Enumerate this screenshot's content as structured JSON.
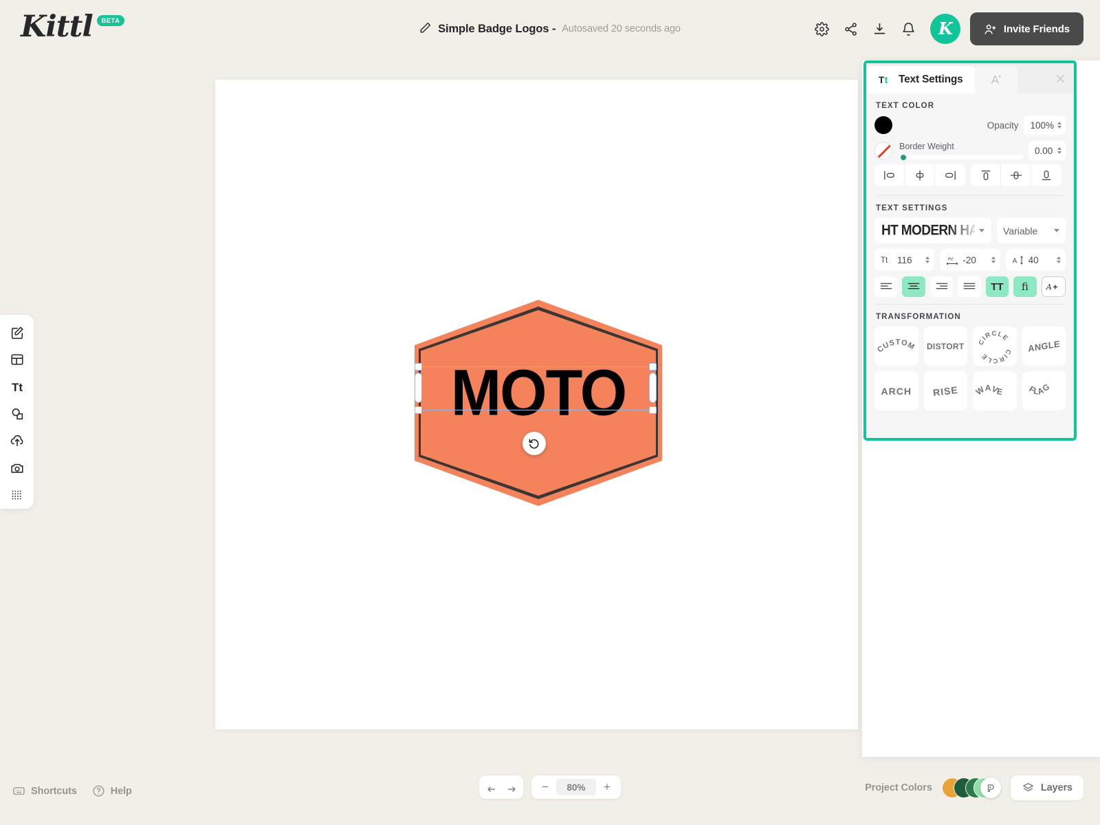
{
  "app": {
    "logo_text": "Kittl",
    "logo_badge": "BETA",
    "accent_color": "#12c49a",
    "canvas_bg": "#f2efe9"
  },
  "header": {
    "doc_name": "Simple Badge Logos -",
    "autosave_text": "Autosaved 20 seconds ago",
    "icons": [
      "gear-icon",
      "share-icon",
      "download-icon",
      "bell-icon"
    ],
    "avatar_letter": "K",
    "invite_label": "Invite Friends"
  },
  "left_toolbar": {
    "items": [
      {
        "name": "design-tool",
        "icon": "pencil-square-icon"
      },
      {
        "name": "templates-tool",
        "icon": "layout-icon"
      },
      {
        "name": "text-tool",
        "icon": "text-Tt-icon"
      },
      {
        "name": "elements-tool",
        "icon": "shapes-icon"
      },
      {
        "name": "uploads-tool",
        "icon": "cloud-upload-icon"
      },
      {
        "name": "photos-tool",
        "icon": "camera-icon"
      },
      {
        "name": "textures-tool",
        "icon": "dots-grid-icon"
      }
    ]
  },
  "canvas": {
    "badge_text": "MOTO",
    "badge_fill": "#f4835c",
    "badge_stroke": "#3b3634",
    "text_color": "#000000"
  },
  "panel": {
    "tab_active": "Text Settings",
    "tab_active_icon": "Tt",
    "tab_secondary_icon": "ai-text-effects-icon",
    "close_icon": "close-icon",
    "text_color": {
      "section_label": "TEXT COLOR",
      "fill_swatch": "#000000",
      "opacity_label": "Opacity",
      "opacity_value": "100%",
      "border_weight_label": "Border Weight",
      "border_weight_value": "0.00",
      "border_swatch": "none"
    },
    "align_buttons": [
      {
        "name": "align-left-icon"
      },
      {
        "name": "align-center-horizontal-icon"
      },
      {
        "name": "align-right-icon"
      },
      {
        "name": "align-top-icon"
      },
      {
        "name": "align-middle-vertical-icon"
      },
      {
        "name": "align-bottom-icon"
      }
    ],
    "text_settings": {
      "section_label": "TEXT SETTINGS",
      "font_family": "HT MODERN HAND",
      "font_variant": "Variable",
      "font_size_label": "Tt",
      "font_size": "116",
      "letter_spacing_label": "AV",
      "letter_spacing": "-20",
      "line_height_label": "A",
      "line_height": "40",
      "align_options": [
        {
          "name": "text-align-left-icon",
          "active": false
        },
        {
          "name": "text-align-center-icon",
          "active": true
        },
        {
          "name": "text-align-right-icon",
          "active": false
        },
        {
          "name": "text-align-justify-icon",
          "active": false
        }
      ],
      "uppercase_label": "TT",
      "uppercase_active": true,
      "ligature_label": "fi",
      "ligature_active": true,
      "more_label": "A+"
    },
    "transformation": {
      "section_label": "TRANSFORMATION",
      "items": [
        "CUSTOM",
        "DISTORT",
        "CIRCLE",
        "ANGLE",
        "ARCH",
        "RISE",
        "WAVE",
        "FLAG"
      ]
    }
  },
  "bottom": {
    "shortcuts_label": "Shortcuts",
    "help_label": "Help",
    "undo_icon": "undo-arrow-icon",
    "redo_icon": "redo-arrow-icon",
    "zoom_out_label": "−",
    "zoom_value": "80%",
    "zoom_in_label": "+",
    "project_colors_label": "Project Colors",
    "project_colors": [
      "#e8a33a",
      "#1f5c3d",
      "#2f7a4d",
      "#8fe0a8"
    ],
    "layers_label": "Layers"
  }
}
